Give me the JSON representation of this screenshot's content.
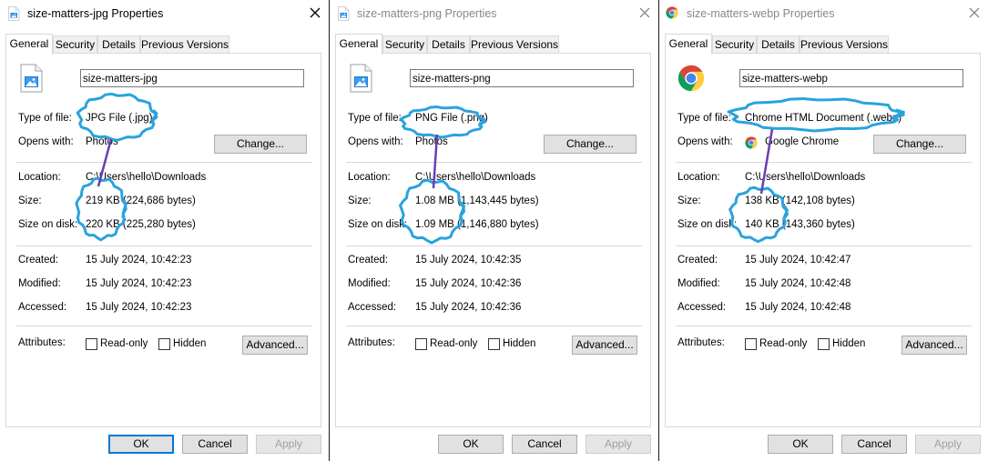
{
  "dialogs": [
    {
      "title": "size-matters-jpg Properties",
      "active": true,
      "icon": "image-file-icon",
      "tabs": [
        "General",
        "Security",
        "Details",
        "Previous Versions"
      ],
      "filename": "size-matters-jpg",
      "labels": {
        "type": "Type of file:",
        "opens": "Opens with:",
        "location": "Location:",
        "size": "Size:",
        "size_on_disk": "Size on disk:",
        "created": "Created:",
        "modified": "Modified:",
        "accessed": "Accessed:",
        "attributes": "Attributes:"
      },
      "type_of_file": "JPG File (.jpg)",
      "opens_with": "Photos",
      "opens_icon": "",
      "change_label": "Change...",
      "location": "C:\\Users\\hello\\Downloads",
      "size": "219 KB (224,686 bytes)",
      "size_on_disk": "220 KB (225,280 bytes)",
      "created": "15 July 2024, 10:42:23",
      "modified": "15 July 2024, 10:42:23",
      "accessed": "15 July 2024, 10:42:23",
      "readonly_label": "Read-only",
      "hidden_label": "Hidden",
      "advanced_label": "Advanced...",
      "ok_label": "OK",
      "cancel_label": "Cancel",
      "apply_label": "Apply"
    },
    {
      "title": "size-matters-png Properties",
      "active": false,
      "icon": "image-file-icon",
      "tabs": [
        "General",
        "Security",
        "Details",
        "Previous Versions"
      ],
      "filename": "size-matters-png",
      "labels": {
        "type": "Type of file:",
        "opens": "Opens with:",
        "location": "Location:",
        "size": "Size:",
        "size_on_disk": "Size on disk:",
        "created": "Created:",
        "modified": "Modified:",
        "accessed": "Accessed:",
        "attributes": "Attributes:"
      },
      "type_of_file": "PNG File (.png)",
      "opens_with": "Photos",
      "opens_icon": "",
      "change_label": "Change...",
      "location": "C:\\Users\\hello\\Downloads",
      "size": "1.08 MB (1,143,445 bytes)",
      "size_on_disk": "1.09 MB (1,146,880 bytes)",
      "created": "15 July 2024, 10:42:35",
      "modified": "15 July 2024, 10:42:36",
      "accessed": "15 July 2024, 10:42:36",
      "readonly_label": "Read-only",
      "hidden_label": "Hidden",
      "advanced_label": "Advanced...",
      "ok_label": "OK",
      "cancel_label": "Cancel",
      "apply_label": "Apply"
    },
    {
      "title": "size-matters-webp Properties",
      "active": false,
      "icon": "chrome-icon",
      "tabs": [
        "General",
        "Security",
        "Details",
        "Previous Versions"
      ],
      "filename": "size-matters-webp",
      "labels": {
        "type": "Type of file:",
        "opens": "Opens with:",
        "location": "Location:",
        "size": "Size:",
        "size_on_disk": "Size on disk:",
        "created": "Created:",
        "modified": "Modified:",
        "accessed": "Accessed:",
        "attributes": "Attributes:"
      },
      "type_of_file": "Chrome HTML Document (.webp)",
      "opens_with": "Google Chrome",
      "opens_icon": "chrome-icon",
      "change_label": "Change...",
      "location": "C:\\Users\\hello\\Downloads",
      "size": "138 KB (142,108 bytes)",
      "size_on_disk": "140 KB (143,360 bytes)",
      "created": "15 July 2024, 10:42:47",
      "modified": "15 July 2024, 10:42:48",
      "accessed": "15 July 2024, 10:42:48",
      "readonly_label": "Read-only",
      "hidden_label": "Hidden",
      "advanced_label": "Advanced...",
      "ok_label": "OK",
      "cancel_label": "Cancel",
      "apply_label": "Apply"
    }
  ],
  "colors": {
    "annotation_circle": "#29a3dd",
    "annotation_line": "#6a3fb5",
    "default_button_border": "#0078d7"
  }
}
